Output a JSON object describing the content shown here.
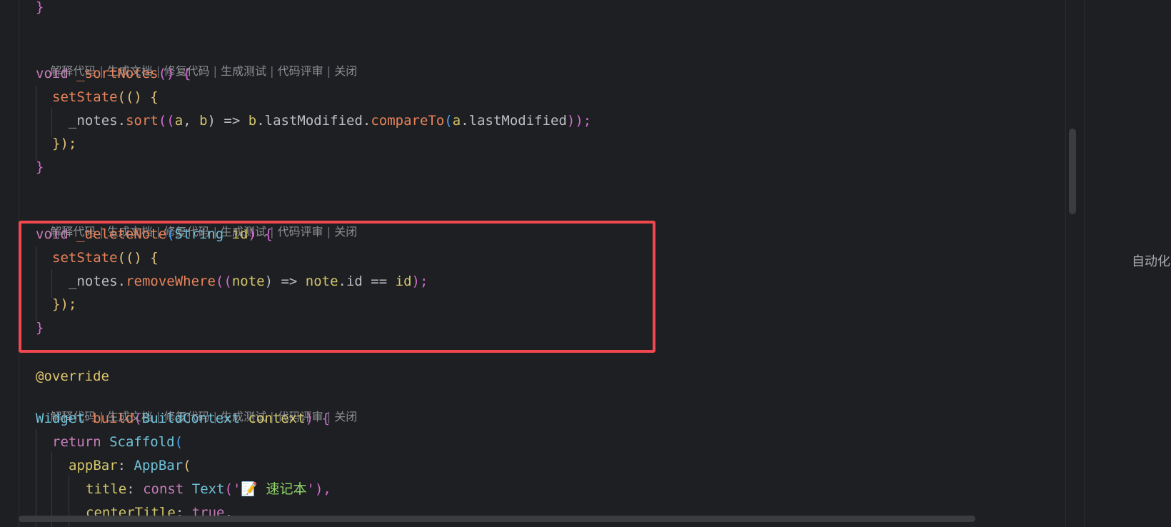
{
  "code_lens_items": [
    "解释代码",
    "生成文档",
    "修复代码",
    "生成测试",
    "代码评审",
    "关闭"
  ],
  "code_lens_separator": " | ",
  "side_panel_label": "自动化",
  "code": {
    "l0": "}",
    "sort_sig_a": "void",
    "sort_sig_b": "_sortNotes",
    "sort_sig_c": "() {",
    "setstate1": "setState",
    "setstate1_b": "(() {",
    "sort_body_a": "_notes.",
    "sort_body_b": "sort",
    "sort_body_c": "((",
    "sort_body_d": "a",
    "sort_body_e": ", ",
    "sort_body_f": "b",
    "sort_body_g": ") => ",
    "sort_body_h": "b",
    "sort_body_i": ".lastModified.",
    "sort_body_j": "compareTo",
    "sort_body_k": "(",
    "sort_body_l": "a",
    "sort_body_m": ".lastModified",
    "sort_body_n": "));",
    "close_setstate": "});",
    "close_fn": "}",
    "del_sig_a": "void",
    "del_sig_b": "_deleteNote",
    "del_sig_c": "(",
    "del_sig_d": "String",
    "del_sig_e": "id",
    "del_sig_f": ") {",
    "setstate2": "setState",
    "setstate2_b": "(() {",
    "del_body_a": "_notes.",
    "del_body_b": "removeWhere",
    "del_body_c": "((",
    "del_body_d": "note",
    "del_body_e": ") => ",
    "del_body_f": "note",
    "del_body_g": ".id == ",
    "del_body_h": "id",
    "del_body_i": ");",
    "close_setstate2": "});",
    "close_fn2": "}",
    "override": "@override",
    "build_a": "Widget",
    "build_b": "build",
    "build_c": "(",
    "build_d": "BuildContext",
    "build_e": "context",
    "build_f": ") {",
    "ret_a": "return",
    "ret_b": "Scaffold",
    "ret_c": "(",
    "appbar_a": "appBar",
    "appbar_b": ": ",
    "appbar_c": "AppBar",
    "appbar_d": "(",
    "title_a": "title",
    "title_b": ": ",
    "title_c": "const",
    "title_d": "Text",
    "title_e": "('",
    "title_f": "📝 速记本",
    "title_g": "'),",
    "center_a": "centerTitle",
    "center_b": ": ",
    "center_c": "true",
    "center_d": ","
  }
}
